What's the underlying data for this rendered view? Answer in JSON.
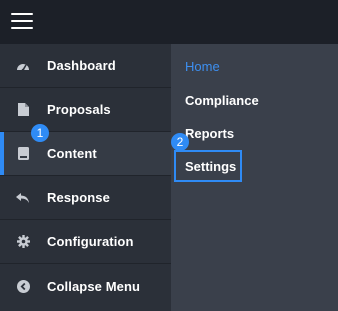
{
  "sidebar": {
    "items": [
      {
        "label": "Dashboard",
        "icon": "dashboard-gauge-icon"
      },
      {
        "label": "Proposals",
        "icon": "document-icon"
      },
      {
        "label": "Content",
        "icon": "book-icon",
        "active": true
      },
      {
        "label": "Response",
        "icon": "reply-arrow-icon"
      },
      {
        "label": "Configuration",
        "icon": "gear-icon"
      },
      {
        "label": "Collapse Menu",
        "icon": "chevron-left-circle-icon"
      }
    ]
  },
  "submenu": {
    "items": [
      {
        "label": "Home"
      },
      {
        "label": "Compliance"
      },
      {
        "label": "Reports"
      },
      {
        "label": "Settings"
      }
    ]
  },
  "badges": {
    "first": "1",
    "second": "2"
  },
  "colors": {
    "accent": "#2f8bf5",
    "link": "#3d8ff0",
    "sidebar_bg": "#2b3039",
    "submenu_bg": "#3a404b",
    "topbar_bg": "#1c2028"
  }
}
